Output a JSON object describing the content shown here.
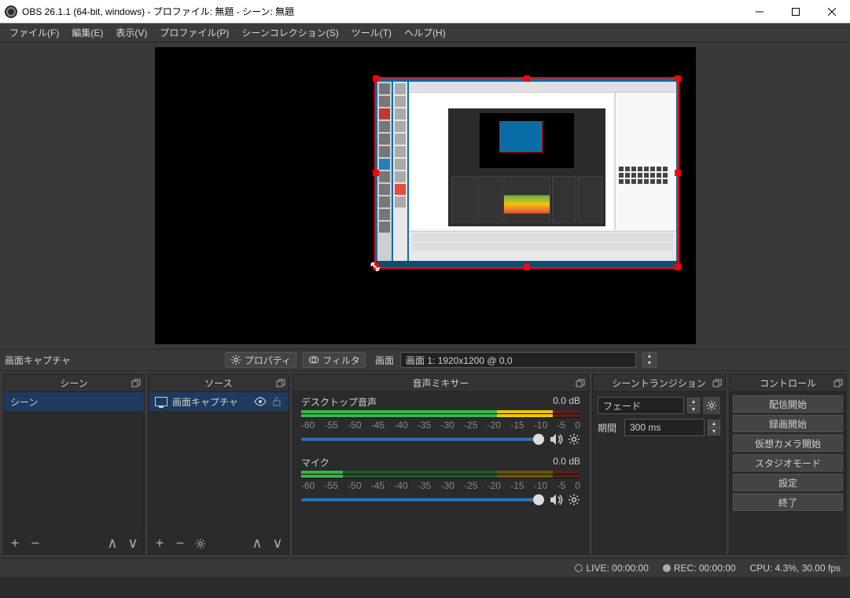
{
  "window": {
    "title": "OBS 26.1.1 (64-bit, windows) - プロファイル: 無題 - シーン: 無題"
  },
  "menu": {
    "file": "ファイル(F)",
    "edit": "編集(E)",
    "view": "表示(V)",
    "profile": "プロファイル(P)",
    "scene_collection": "シーンコレクション(S)",
    "tools": "ツール(T)",
    "help": "ヘルプ(H)"
  },
  "midbar": {
    "selected_source": "画面キャプチャ",
    "properties": "プロパティ",
    "filters": "フィルタ",
    "screen_label": "画面",
    "screen_value": "画面 1: 1920x1200 @ 0,0"
  },
  "panels": {
    "scenes": {
      "title": "シーン",
      "items": [
        "シーン"
      ]
    },
    "sources": {
      "title": "ソース",
      "items": [
        "画面キャプチャ"
      ]
    },
    "mixer": {
      "title": "音声ミキサー",
      "channels": [
        {
          "name": "デスクトップ音声",
          "db": "0.0 dB"
        },
        {
          "name": "マイク",
          "db": "0.0 dB"
        }
      ],
      "scale": [
        "-60",
        "-55",
        "-50",
        "-45",
        "-40",
        "-35",
        "-30",
        "-25",
        "-20",
        "-15",
        "-10",
        "-5",
        "0"
      ]
    },
    "transitions": {
      "title": "シーントランジション",
      "type": "フェード",
      "duration_label": "期間",
      "duration_value": "300 ms"
    },
    "controls": {
      "title": "コントロール",
      "buttons": [
        "配信開始",
        "録画開始",
        "仮想カメラ開始",
        "スタジオモード",
        "設定",
        "終了"
      ]
    }
  },
  "statusbar": {
    "live": "LIVE: 00:00:00",
    "rec": "REC: 00:00:00",
    "cpu": "CPU: 4.3%, 30.00 fps"
  }
}
